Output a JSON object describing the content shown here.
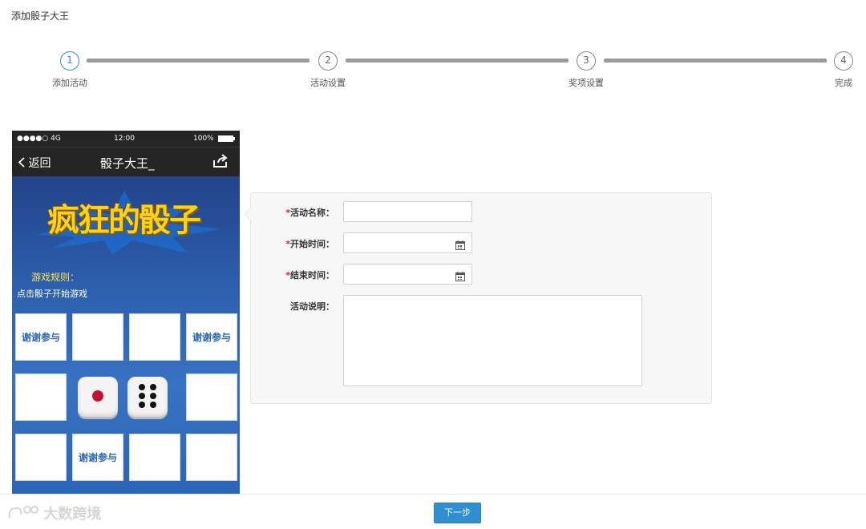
{
  "page": {
    "title": "添加骰子大王"
  },
  "steps": [
    {
      "num": "1",
      "label": "添加活动",
      "active": true
    },
    {
      "num": "2",
      "label": "活动设置",
      "active": false
    },
    {
      "num": "3",
      "label": "奖项设置",
      "active": false
    },
    {
      "num": "4",
      "label": "完成",
      "active": false
    }
  ],
  "phone": {
    "status": {
      "signal": "●●●●○ 4G",
      "time": "12:00",
      "battery": "100%"
    },
    "nav": {
      "back_label": "返回",
      "title": "骰子大王_"
    },
    "banner": "疯狂的骰子",
    "rules_title": "游戏规则：",
    "rules_text": "点击骰子开始游戏",
    "cells": {
      "r1c1": "谢谢参与",
      "r1c4": "谢谢参与",
      "r3c2": "谢谢参与"
    }
  },
  "form": {
    "name_label": "活动名称：",
    "start_label": "开始时间：",
    "end_label": "结束时间：",
    "desc_label": "活动说明：",
    "required_mark": "*",
    "name_value": "",
    "start_value": "",
    "end_value": "",
    "desc_value": ""
  },
  "footer": {
    "next_label": "下一步",
    "watermark": "大数跨境"
  },
  "colors": {
    "accent": "#2f8fd0",
    "required": "#e02020",
    "phone_bg": "#2a66b5"
  }
}
